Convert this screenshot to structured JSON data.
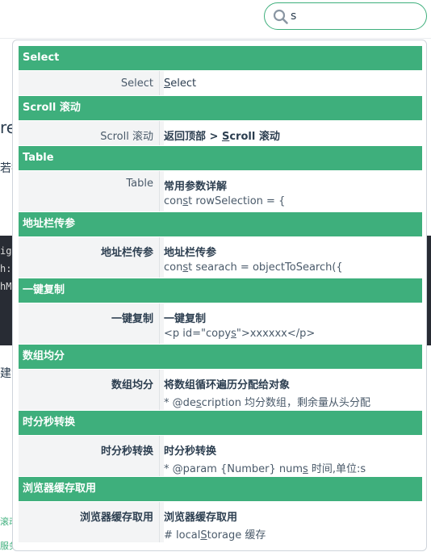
{
  "search": {
    "value": "s",
    "accent": "#3eaf7c"
  },
  "background": {
    "frag_re": "re",
    "frag_a": "若搜",
    "code_lines": [
      "igu",
      "h: ",
      "hM"
    ],
    "frag_b": "建索",
    "link_a": "滚动",
    "link_b": "服务"
  },
  "suggestions": [
    {
      "header": "Select",
      "left": "Select",
      "title": [
        "",
        "S",
        "elect"
      ],
      "sub": null
    },
    {
      "header": "Scroll 滚动",
      "left": "Scroll 滚动",
      "title": [
        "返回顶部 > ",
        "S",
        "croll 滚动"
      ],
      "sub": null
    },
    {
      "header": "Table",
      "left": "Table",
      "title": [
        "常用参数详解"
      ],
      "sub": [
        "con",
        "s",
        "t rowSelection = {"
      ]
    },
    {
      "header": "地址栏传参",
      "left": "地址栏传参",
      "title": [
        "地址栏传参"
      ],
      "sub": [
        "con",
        "s",
        "t searach = objectToSearch({"
      ]
    },
    {
      "header": "一键复制",
      "left": "一键复制",
      "title": [
        "一键复制"
      ],
      "sub": [
        "<p id=\"copy",
        "s",
        "\">xxxxxx</p>"
      ]
    },
    {
      "header": "数组均分",
      "left": "数组均分",
      "title": [
        "将数组循环遍历分配给对象"
      ],
      "sub": [
        "* @de",
        "s",
        "cription 均分数组，剩余量从头分配"
      ]
    },
    {
      "header": "时分秒转换",
      "left": "时分秒转换",
      "title": [
        "时分秒转换"
      ],
      "sub": [
        "* @param {Number} num",
        "s",
        " 时间,单位:s"
      ]
    },
    {
      "header": "浏览器缓存取用",
      "left": "浏览器缓存取用",
      "title": [
        "浏览器缓存取用"
      ],
      "sub": [
        "# local",
        "S",
        "torage 缓存"
      ]
    }
  ]
}
